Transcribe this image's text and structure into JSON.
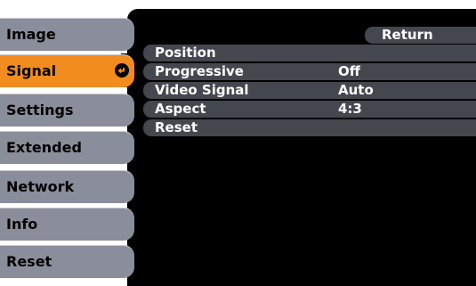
{
  "tabs": [
    {
      "label": "Image",
      "active": false
    },
    {
      "label": "Signal",
      "active": true
    },
    {
      "label": "Settings",
      "active": false
    },
    {
      "label": "Extended",
      "active": false
    },
    {
      "label": "Network",
      "active": false
    },
    {
      "label": "Info",
      "active": false
    },
    {
      "label": "Reset",
      "active": false
    }
  ],
  "return_label": "Return",
  "rows": [
    {
      "label": "Position",
      "value": ""
    },
    {
      "label": "Progressive",
      "value": "Off"
    },
    {
      "label": "Video Signal",
      "value": "Auto"
    },
    {
      "label": "Aspect",
      "value": "4:3"
    },
    {
      "label": "Reset",
      "value": ""
    }
  ],
  "colors": {
    "tab_bg": "#8a8d9a",
    "tab_active_bg": "#f28c1f",
    "panel_bg": "#000000",
    "row_bg": "#45474f",
    "text_light": "#ffffff"
  },
  "icons": {
    "active_tab_icon": "enter-icon"
  }
}
